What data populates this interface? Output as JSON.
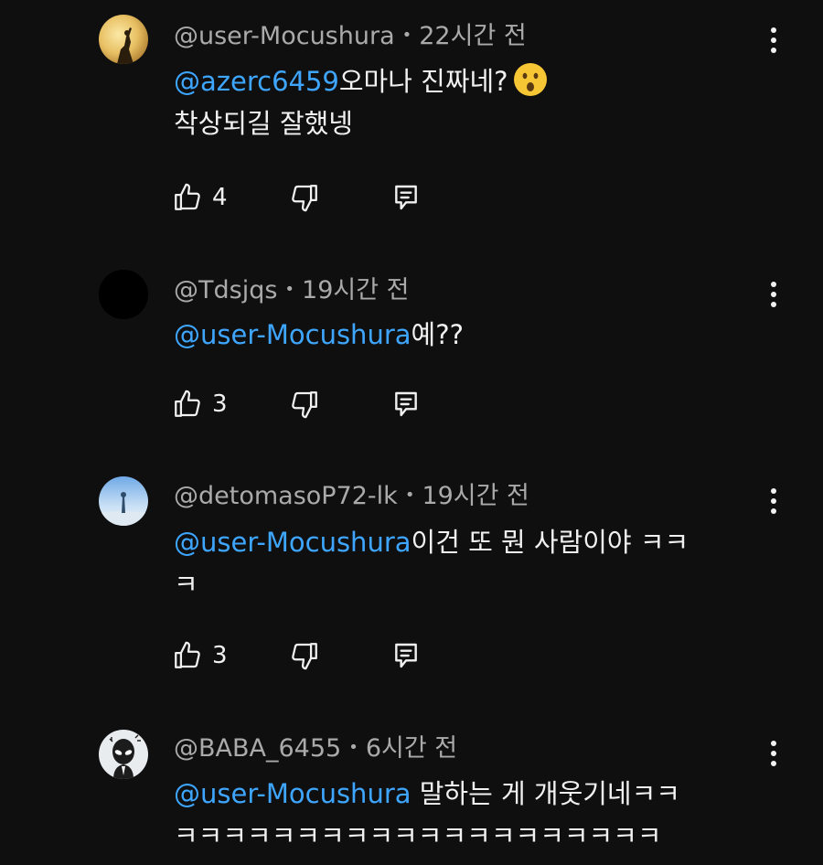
{
  "comments": [
    {
      "author": "@user-Mocushura",
      "time": "22시간 전",
      "mention": "@azerc6459",
      "text_line1": "오마나 진짜네?",
      "text_line2": "착상되길 잘했넹",
      "emoji": "astonished-face-emoji",
      "likes": "4"
    },
    {
      "author": "@Tdsjqs",
      "time": "19시간 전",
      "mention": "@user-Mocushura",
      "text_line1": "예??",
      "likes": "3"
    },
    {
      "author": "@detomasoP72-lk",
      "time": "19시간 전",
      "mention": "@user-Mocushura",
      "text_line1": "이건 또 뭔 사람이야 ㅋㅋ",
      "text_line2": "ㅋ",
      "likes": "3"
    },
    {
      "author": "@BABA_6455",
      "time": "6시간 전",
      "mention": "@user-Mocushura",
      "text_line1": " 말하는 게 개웃기네ㅋㅋ",
      "text_line2": "ㅋㅋㅋㅋㅋㅋㅋㅋㅋㅋㅋㅋㅋㅋㅋㅋㅋㅋㅋㅋ"
    }
  ],
  "separator": "•",
  "icons": {
    "like": "thumbs-up-icon",
    "dislike": "thumbs-down-icon",
    "reply": "reply-comment-icon",
    "more": "more-vertical-icon"
  },
  "colors": {
    "background": "#0f0f0f",
    "text": "#f1f1f1",
    "meta": "#aaaaaa",
    "mention": "#3ea6ff"
  }
}
